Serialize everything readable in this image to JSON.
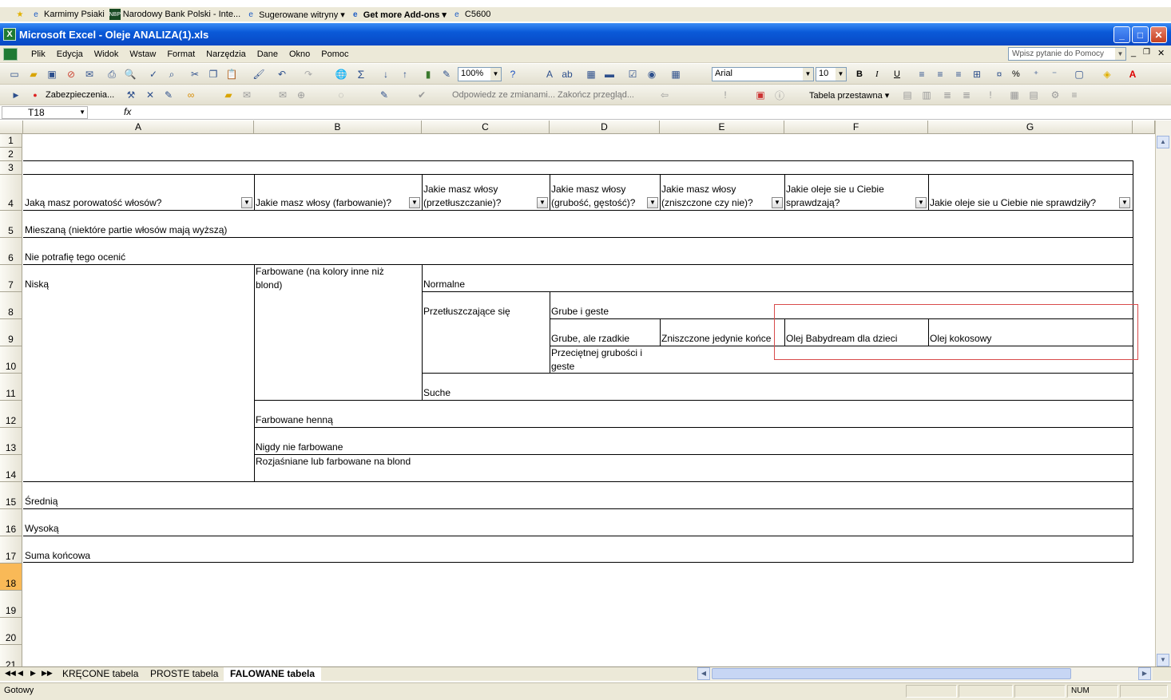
{
  "favorites": [
    {
      "label": "Karmimy Psiaki",
      "icon": "ie-page-icon"
    },
    {
      "label": "Narodowy Bank Polski - Inte...",
      "icon": "nbp-icon"
    },
    {
      "label": "Sugerowane witryny ▾",
      "icon": "ie-icon"
    },
    {
      "label": "Get more Add-ons ▾",
      "icon": "ie-icon"
    },
    {
      "label": "C5600",
      "icon": "ie-page-icon"
    }
  ],
  "window": {
    "title": "Microsoft Excel - Oleje ANALIZA(1).xls"
  },
  "menu": [
    "Plik",
    "Edycja",
    "Widok",
    "Wstaw",
    "Format",
    "Narzędzia",
    "Dane",
    "Okno",
    "Pomoc"
  ],
  "help": {
    "placeholder": "Wpisz pytanie do Pomocy"
  },
  "toolbar": {
    "zoom": "100%",
    "font": "Arial",
    "font_size": "10",
    "security_label": "Zabezpieczenia...",
    "reply_label": "Odpowiedz ze zmianami...",
    "end_review_label": "Zakończ przegląd...",
    "pivot_label": "Tabela przestawna ▾",
    "bold": "B",
    "italic": "I",
    "underline": "U",
    "percent": "%"
  },
  "formula": {
    "name_box": "T18",
    "fx": "fx",
    "value": ""
  },
  "columns": [
    "A",
    "B",
    "C",
    "D",
    "E",
    "F",
    "G"
  ],
  "rows": [
    "1",
    "2",
    "3",
    "4",
    "5",
    "6",
    "7",
    "8",
    "9",
    "10",
    "11",
    "12",
    "13",
    "14",
    "15",
    "16",
    "17",
    "18",
    "19",
    "20",
    "21"
  ],
  "selected_row": "18",
  "headers": {
    "a": "Jaką masz porowatość włosów?",
    "b": "Jakie masz włosy (farbowanie)?",
    "c": "Jakie masz włosy (przetłuszczanie)?",
    "d": "Jakie masz włosy (grubość, gęstość)?",
    "e": "Jakie masz włosy (zniszczone czy nie)?",
    "f": "Jakie oleje sie u Ciebie sprawdzają?",
    "g": "Jakie oleje sie u Ciebie nie sprawdziły?"
  },
  "cells": {
    "a5": "Mieszaną (niektóre partie włosów mają wyższą)",
    "a6": "Nie potrafię tego ocenić",
    "a7": "Niską",
    "b7": "Farbowane (na kolory inne niż blond)",
    "c7": "Normalne",
    "c8": "Przetłuszczające się",
    "d8": "Grube i geste",
    "d9": "Grube, ale rzadkie",
    "e9": "Zniszczone jedynie końce",
    "f9": "Olej Babydream dla dzieci",
    "g9": "Olej kokosowy",
    "d10": "Przeciętnej grubości i geste",
    "c11": "Suche",
    "b12": "Farbowane henną",
    "b13": "Nigdy nie farbowane",
    "b14": "Rozjaśniane lub farbowane na blond",
    "a15": "Średnią",
    "a16": "Wysoką",
    "a17": "Suma końcowa"
  },
  "sheets": [
    "KRĘCONE tabela",
    "PROSTE tabela",
    "FALOWANE tabela"
  ],
  "active_sheet": "FALOWANE tabela",
  "status": {
    "text": "Gotowy",
    "num": "NUM"
  }
}
